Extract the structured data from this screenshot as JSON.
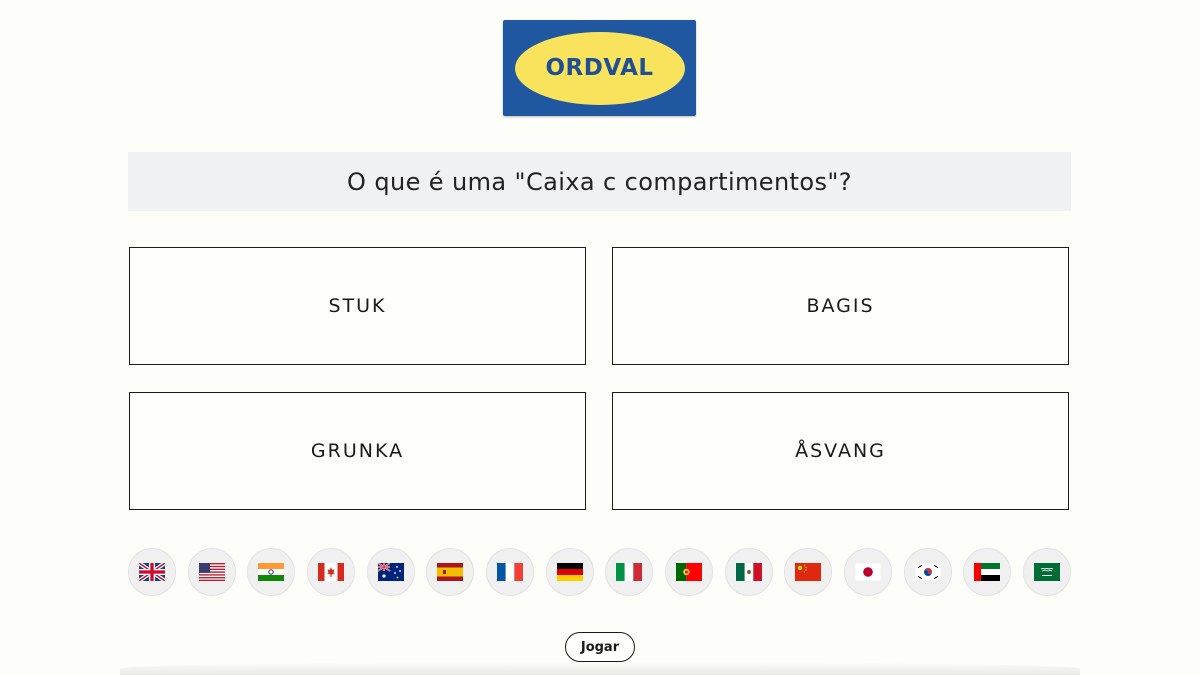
{
  "logo": {
    "text": "ORDVAL",
    "background": "#1f57a0",
    "oval": "#f9e25c"
  },
  "question": {
    "text": "O que é uma \"Caixa c compartimentos\"?"
  },
  "options": [
    {
      "label": "STUK"
    },
    {
      "label": "BAGIS"
    },
    {
      "label": "GRUNKA"
    },
    {
      "label": "ÅSVANG"
    }
  ],
  "languages": [
    {
      "icon": "uk-flag-icon"
    },
    {
      "icon": "us-flag-icon"
    },
    {
      "icon": "india-flag-icon"
    },
    {
      "icon": "canada-flag-icon"
    },
    {
      "icon": "australia-flag-icon"
    },
    {
      "icon": "spain-flag-icon"
    },
    {
      "icon": "france-flag-icon"
    },
    {
      "icon": "germany-flag-icon"
    },
    {
      "icon": "italy-flag-icon"
    },
    {
      "icon": "portugal-flag-icon"
    },
    {
      "icon": "mexico-flag-icon"
    },
    {
      "icon": "china-flag-icon"
    },
    {
      "icon": "japan-flag-icon"
    },
    {
      "icon": "south-korea-flag-icon"
    },
    {
      "icon": "uae-flag-icon"
    },
    {
      "icon": "saudi-arabia-flag-icon"
    }
  ],
  "play_button": {
    "label": "Jogar"
  }
}
